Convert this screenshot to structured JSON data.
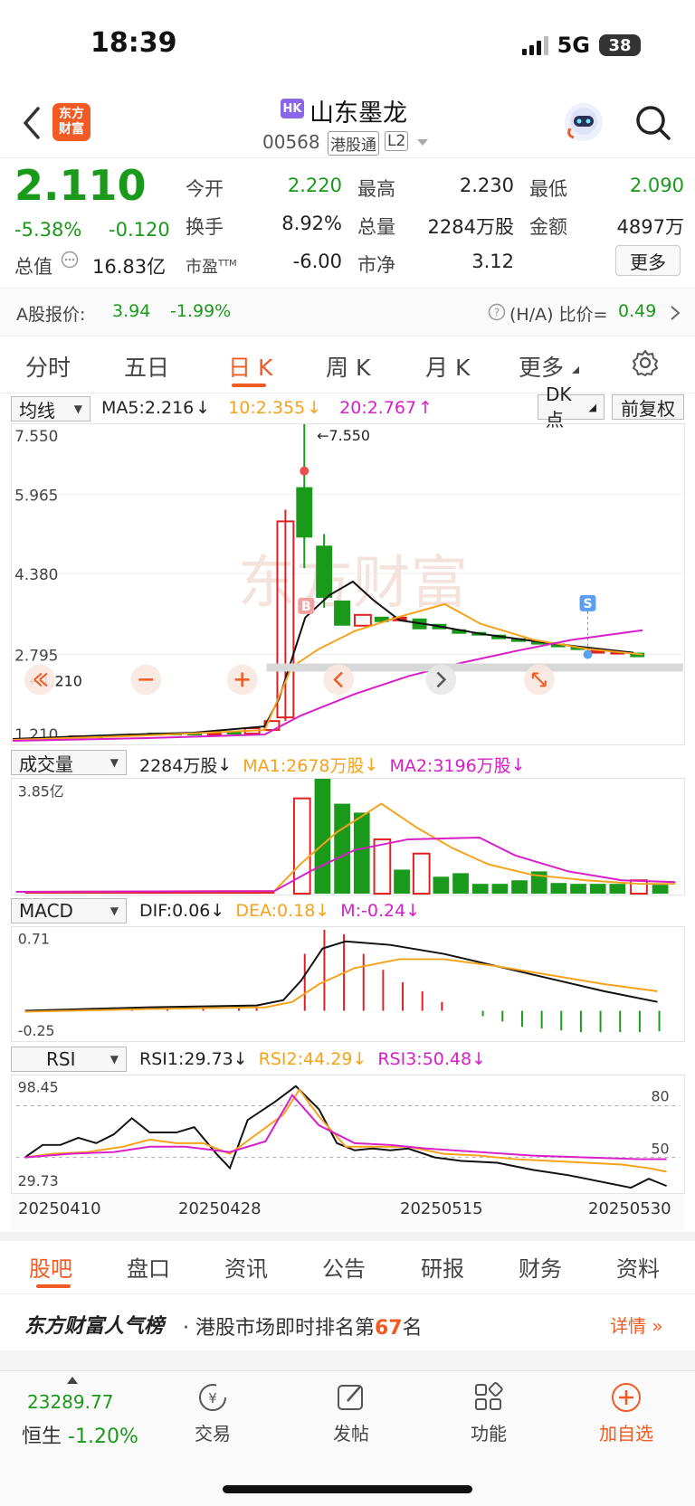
{
  "status_bar": {
    "time": "18:39",
    "network": "5G",
    "battery": "38"
  },
  "header": {
    "back_icon": "chevron-left-icon",
    "logo_text": [
      "东方",
      "财富"
    ],
    "market_badge": "HK",
    "stock_name": "山东墨龙",
    "stock_code": "00568",
    "connect_badge": "港股通",
    "level_badge": "L2",
    "assistant_icon": "robot-avatar-icon",
    "search_icon": "search-icon"
  },
  "quote": {
    "price": "2.110",
    "change_pct": "-5.38%",
    "change": "-0.120",
    "market_cap_label": "总值",
    "market_cap": "16.83亿",
    "open_label": "今开",
    "open": "2.220",
    "high_label": "最高",
    "high": "2.230",
    "low_label": "最低",
    "low": "2.090",
    "turnover_label": "换手",
    "turnover": "8.92%",
    "volume_label": "总量",
    "volume": "2284万股",
    "amount_label": "金额",
    "amount": "4897万",
    "pe_label": "市盈",
    "pe_sup": "TTM",
    "pe": "-6.00",
    "pb_label": "市净",
    "pb": "3.12",
    "more_button": "更多"
  },
  "a_share": {
    "label": "A股报价:",
    "price": "3.94",
    "change_pct": "-1.99%",
    "ratio_label": "(H/A) 比价=",
    "ratio": "0.49"
  },
  "period_tabs": [
    "分时",
    "五日",
    "日 K",
    "周 K",
    "月 K",
    "更多"
  ],
  "active_period": 2,
  "kline": {
    "ma_selector": "均线",
    "ma5": "MA5:2.216",
    "ma10": "10:2.355",
    "ma20": "20:2.767",
    "dk_button": "DK点",
    "adjust_button": "前复权",
    "y_ticks": [
      "7.550",
      "5.965",
      "4.380",
      "2.795",
      "1.210"
    ],
    "max_label": "7.550",
    "min_label": "1.210",
    "buy_marker": "B",
    "sell_marker": "S",
    "watermark": "东方财富"
  },
  "volume": {
    "selector": "成交量",
    "current": "2284万股",
    "ma1": "MA1:2678万股",
    "ma2": "MA2:3196万股",
    "max_tick": "3.85亿"
  },
  "macd": {
    "selector": "MACD",
    "dif": "DIF:0.06",
    "dea": "DEA:0.18",
    "m": "M:-0.24",
    "top_tick": "0.71",
    "bottom_tick": "-0.25"
  },
  "rsi": {
    "selector": "RSI",
    "rsi1": "RSI1:29.73",
    "rsi2": "RSI2:44.29",
    "rsi3": "RSI3:50.48",
    "top_tick": "98.45",
    "bottom_tick": "29.73",
    "level_80": "80",
    "level_50": "50"
  },
  "x_dates": [
    "20250410",
    "20250428",
    "20250515",
    "20250530"
  ],
  "bottom_tabs": [
    "股吧",
    "盘口",
    "资讯",
    "公告",
    "研报",
    "财务",
    "资料"
  ],
  "ranking": {
    "brand": "东方财富人气榜",
    "text_prefix": "· 港股市场即时排名第",
    "rank": "67",
    "text_suffix": "名",
    "detail": "详情"
  },
  "bottom_nav": {
    "index_value": "23289.77",
    "index_name": "恒生",
    "index_change": "-1.20%",
    "items": [
      "交易",
      "发帖",
      "功能",
      "加自选"
    ]
  },
  "colors": {
    "up": "#e02020",
    "down": "#1a9a1a",
    "ma10": "#f6a21a",
    "ma20": "#d81ec8",
    "accent": "#f15a22"
  },
  "chart_data": [
    {
      "type": "candlestick",
      "title": "日K",
      "x_start_label": "20250410",
      "x_end_label": "20250530",
      "ylim": [
        1.21,
        7.55
      ],
      "series": [
        {
          "name": "MA5",
          "values": [
            2.216
          ]
        },
        {
          "name": "MA10",
          "values": [
            2.355
          ]
        },
        {
          "name": "MA20",
          "values": [
            2.767
          ]
        }
      ],
      "notes": "Daily K-line; peak 7.550, low 1.210"
    },
    {
      "type": "bar",
      "title": "成交量",
      "ylim": [
        0,
        385000000
      ],
      "current_volume": "2284万股"
    },
    {
      "type": "line",
      "title": "RSI",
      "ylim": [
        29.73,
        98.45
      ],
      "series": [
        {
          "name": "RSI1",
          "values": [
            29.73
          ]
        },
        {
          "name": "RSI2",
          "values": [
            44.29
          ]
        },
        {
          "name": "RSI3",
          "values": [
            50.48
          ]
        }
      ]
    }
  ]
}
